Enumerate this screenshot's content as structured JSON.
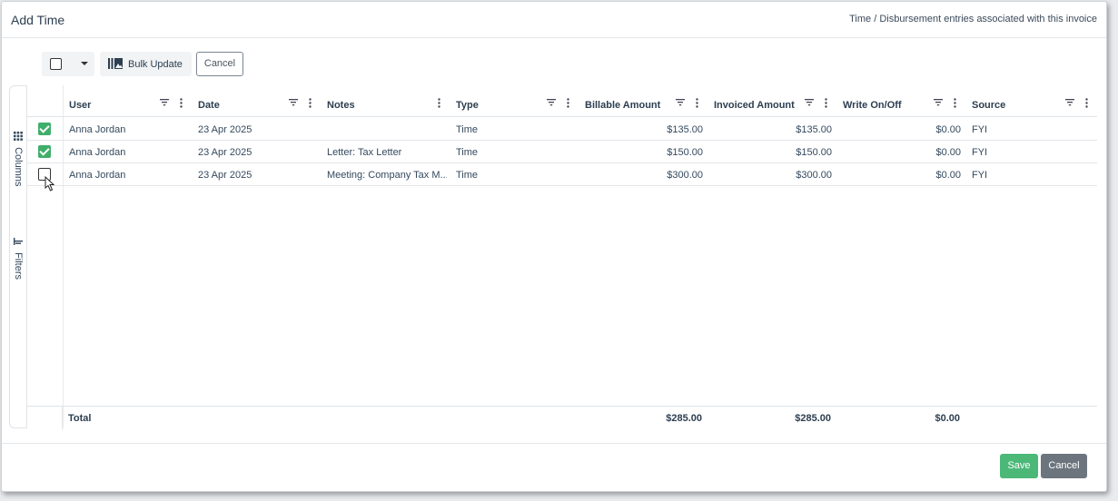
{
  "modal": {
    "title": "Add Time",
    "subtitle": "Time / Disbursement entries associated with this invoice"
  },
  "toolbar": {
    "bulk_update_label": "Bulk Update",
    "cancel_label": "Cancel",
    "select_all_icon": "checkbox-icon",
    "dropdown_icon": "caret-down-icon",
    "bulk_update_icon": "bulk-update-icon"
  },
  "side_panel": {
    "columns_label": "Columns",
    "filters_label": "Filters",
    "columns_icon": "grid-icon",
    "filters_icon": "filter-bar-icon"
  },
  "grid": {
    "columns": [
      {
        "key": "user",
        "label": "User"
      },
      {
        "key": "date",
        "label": "Date"
      },
      {
        "key": "notes",
        "label": "Notes"
      },
      {
        "key": "type",
        "label": "Type"
      },
      {
        "key": "billable",
        "label": "Billable Amount"
      },
      {
        "key": "invoiced",
        "label": "Invoiced Amount"
      },
      {
        "key": "writeon",
        "label": "Write On/Off"
      },
      {
        "key": "source",
        "label": "Source"
      }
    ],
    "rows": [
      {
        "checked": true,
        "user": "Anna Jordan",
        "date": "23 Apr 2025",
        "notes": "",
        "type": "Time",
        "billable": "$135.00",
        "invoiced": "$135.00",
        "writeon": "$0.00",
        "source": "FYI"
      },
      {
        "checked": true,
        "user": "Anna Jordan",
        "date": "23 Apr 2025",
        "notes": "Letter: Tax Letter",
        "type": "Time",
        "billable": "$150.00",
        "invoiced": "$150.00",
        "writeon": "$0.00",
        "source": "FYI"
      },
      {
        "checked": false,
        "user": "Anna Jordan",
        "date": "23 Apr 2025",
        "notes": "Meeting: Company Tax M...",
        "type": "Time",
        "billable": "$300.00",
        "invoiced": "$300.00",
        "writeon": "$0.00",
        "source": "FYI"
      }
    ],
    "totals": {
      "label": "Total",
      "billable": "$285.00",
      "invoiced": "$285.00",
      "writeon": "$0.00"
    }
  },
  "footer": {
    "save_label": "Save",
    "cancel_label": "Cancel"
  },
  "colors": {
    "accent_green": "#4bb878",
    "checkbox_green": "#3fae6a",
    "secondary_gray": "#6c757d"
  }
}
